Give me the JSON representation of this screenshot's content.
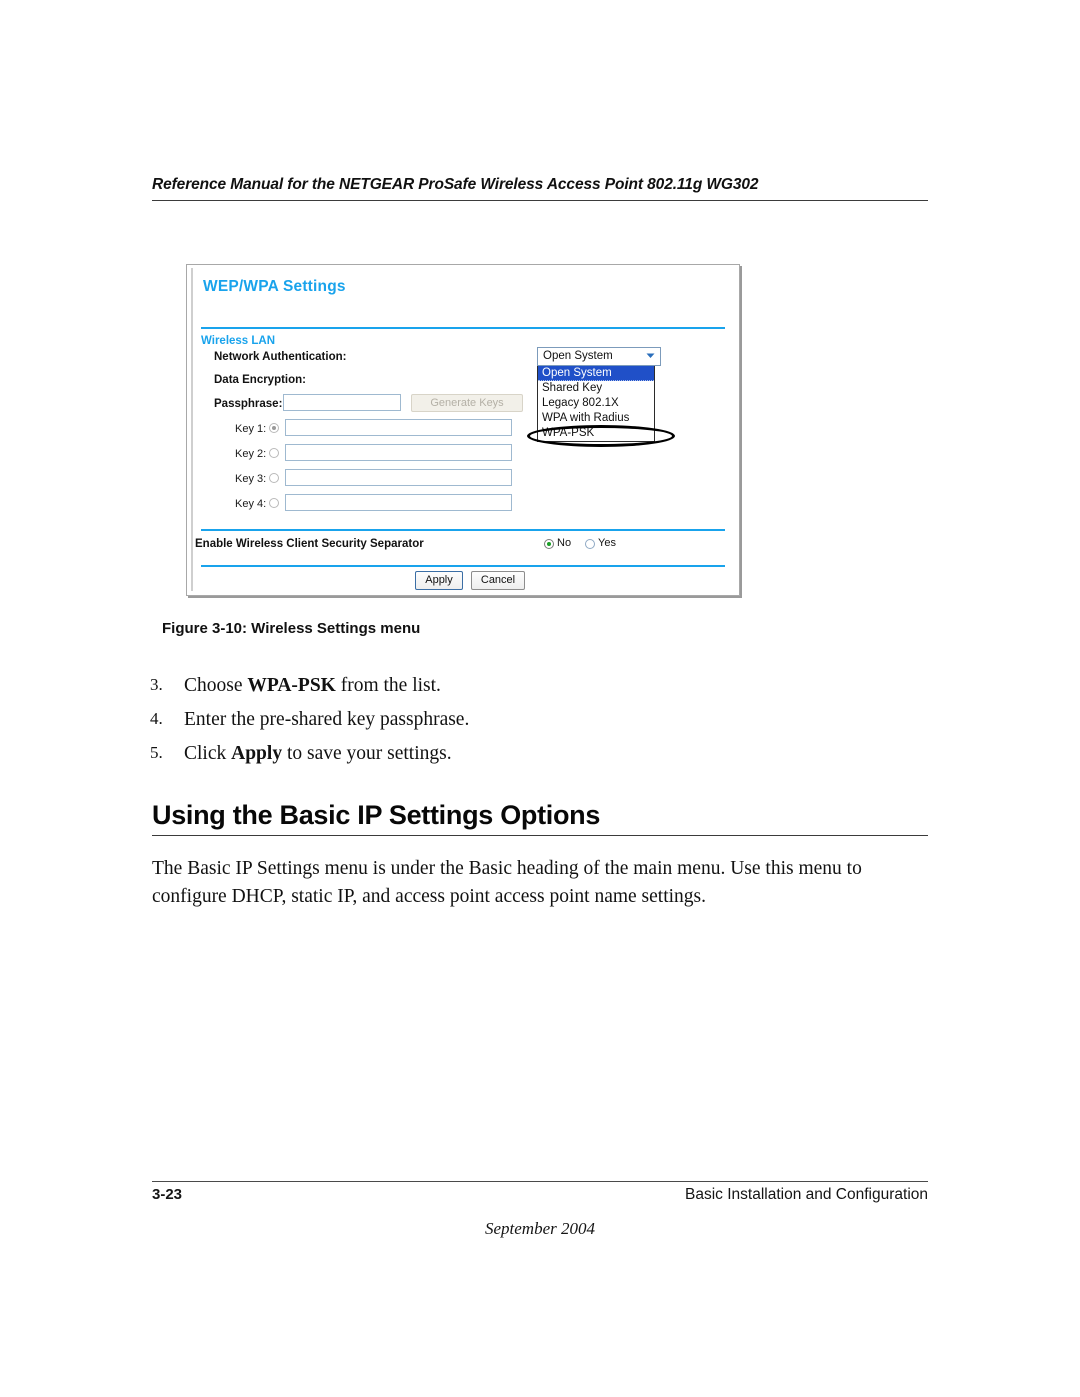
{
  "page": {
    "running_header": "Reference Manual for the NETGEAR ProSafe Wireless Access Point 802.11g WG302",
    "footer_page_number": "3-23",
    "footer_chapter": "Basic Installation and Configuration",
    "footer_date": "September 2004"
  },
  "figure": {
    "caption": "Figure 3-10:  Wireless Settings menu",
    "accent_color": "#19a3ec",
    "panel": {
      "title": "WEP/WPA Settings",
      "section_label": "Wireless LAN",
      "labels": {
        "network_authentication": "Network Authentication:",
        "data_encryption": "Data Encryption:",
        "passphrase": "Passphrase:",
        "security_separator": "Enable Wireless Client Security Separator"
      },
      "passphrase_value": "",
      "generate_keys_label": "Generate Keys",
      "keys": [
        {
          "label": "Key 1:",
          "value": "",
          "selected": true
        },
        {
          "label": "Key 2:",
          "value": "",
          "selected": false
        },
        {
          "label": "Key 3:",
          "value": "",
          "selected": false
        },
        {
          "label": "Key 4:",
          "value": "",
          "selected": false
        }
      ],
      "separator_options": [
        {
          "label": "No",
          "selected": true
        },
        {
          "label": "Yes",
          "selected": false
        }
      ],
      "dropdown": {
        "selected_value": "Open System",
        "options": [
          "Open System",
          "Shared Key",
          "Legacy 802.1X",
          "WPA with Radius",
          "WPA-PSK"
        ],
        "highlighted_option": "WPA-PSK"
      },
      "buttons": {
        "apply": "Apply",
        "cancel": "Cancel"
      }
    }
  },
  "steps": [
    {
      "number": "3.",
      "text_before": "Choose ",
      "bold": "WPA-PSK",
      "text_after": " from the list."
    },
    {
      "number": "4.",
      "text_before": "Enter the pre-shared key passphrase.",
      "bold": "",
      "text_after": ""
    },
    {
      "number": "5.",
      "text_before": "Click ",
      "bold": "Apply",
      "text_after": " to save your settings."
    }
  ],
  "section": {
    "heading": "Using the Basic IP Settings Options",
    "paragraph": "The Basic IP Settings menu is under the Basic heading of the main menu. Use this menu to configure DHCP, static IP, and access point access point name settings."
  }
}
